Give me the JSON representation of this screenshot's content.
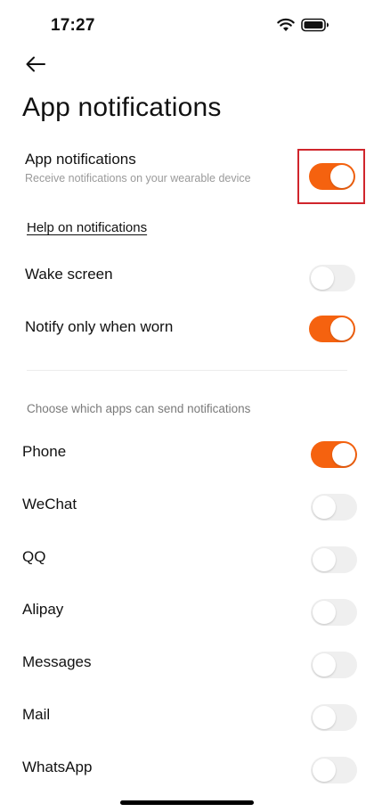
{
  "status_bar": {
    "time": "17:27",
    "wifi_icon": "wifi-icon",
    "battery_icon": "battery-icon"
  },
  "header": {
    "back_icon": "arrow-left-icon",
    "title": "App notifications"
  },
  "master": {
    "label": "App notifications",
    "description": "Receive notifications on your wearable device",
    "enabled": true
  },
  "help_link": "Help on notifications",
  "settings": [
    {
      "label": "Wake screen",
      "enabled": false
    },
    {
      "label": "Notify only when worn",
      "enabled": true
    }
  ],
  "apps_section": {
    "header": "Choose which apps can send notifications",
    "apps": [
      {
        "label": "Phone",
        "enabled": true
      },
      {
        "label": "WeChat",
        "enabled": false
      },
      {
        "label": "QQ",
        "enabled": false
      },
      {
        "label": "Alipay",
        "enabled": false
      },
      {
        "label": "Messages",
        "enabled": false
      },
      {
        "label": "Mail",
        "enabled": false
      },
      {
        "label": "WhatsApp",
        "enabled": false
      }
    ]
  },
  "colors": {
    "accent": "#f5620f",
    "toggle_off": "#efefef",
    "highlight": "#d0252c",
    "text": "#111111",
    "secondary_text": "#9a9a9a"
  }
}
